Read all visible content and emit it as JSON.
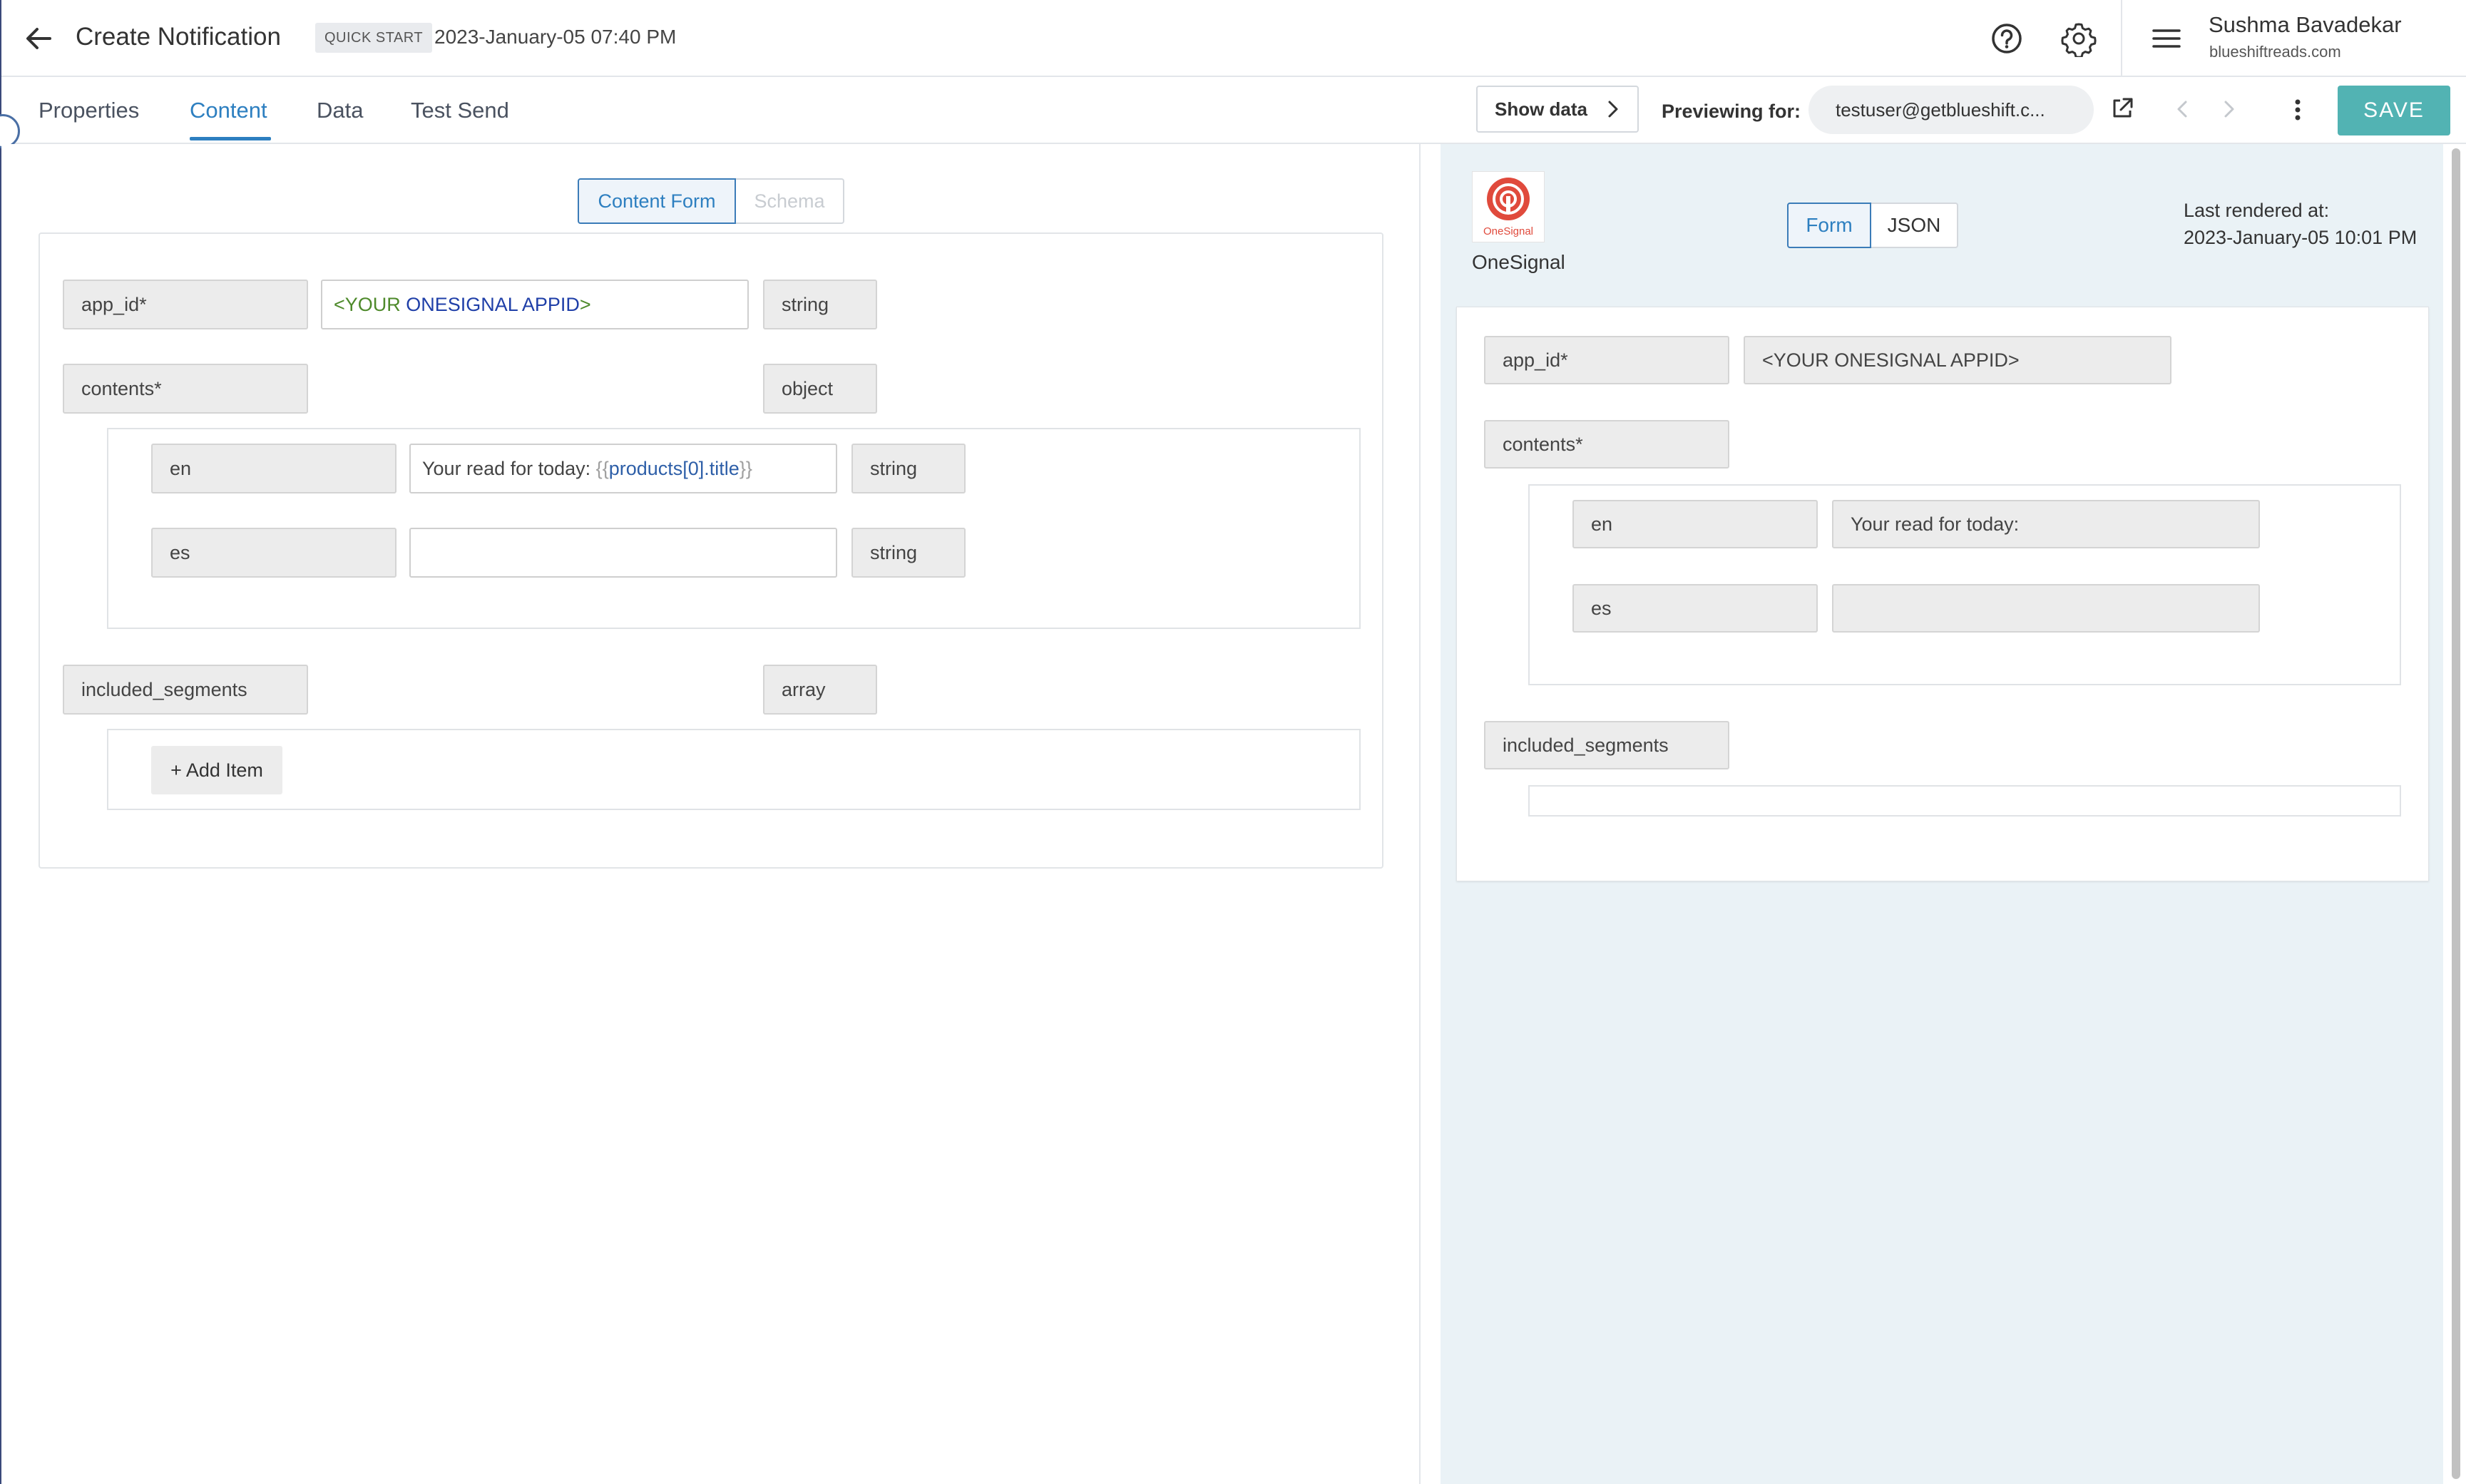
{
  "header": {
    "title": "Create Notification",
    "badge": "QUICK START",
    "timestamp": "2023-January-05 07:40 PM",
    "user_name": "Sushma Bavadekar",
    "user_org": "blueshiftreads.com",
    "icons": [
      "back-arrow-icon",
      "help-icon",
      "gear-icon",
      "menu-icon"
    ]
  },
  "tabs": {
    "items": [
      "Properties",
      "Content",
      "Data",
      "Test Send"
    ],
    "active": "Content"
  },
  "toolbar": {
    "show_data": "Show data",
    "previewing_label": "Previewing for:",
    "preview_user": "testuser@getblueshift.c...",
    "save": "SAVE"
  },
  "editor": {
    "modes": [
      "Content Form",
      "Schema"
    ],
    "active_mode": "Content Form",
    "fields": {
      "app_id": {
        "label": "app_id*",
        "value_open": "<YOUR ",
        "value_mid": "ONESIGNAL APPID",
        "value_close": ">",
        "type": "string"
      },
      "contents": {
        "label": "contents*",
        "type": "object"
      },
      "en": {
        "label": "en",
        "value_text": "Your read for today: ",
        "value_open": "{{",
        "value_var": "products[0].title",
        "value_close": "}}",
        "type": "string"
      },
      "es": {
        "label": "es",
        "value": "",
        "type": "string"
      },
      "included_segments": {
        "label": "included_segments",
        "type": "array"
      }
    },
    "add_item": "+ Add Item"
  },
  "preview": {
    "provider_name": "OneSignal",
    "logo_text": "OneSignal",
    "view_modes": [
      "Form",
      "JSON"
    ],
    "active_view": "Form",
    "last_rendered_label": "Last rendered at:",
    "last_rendered_time": "2023-January-05 10:01 PM",
    "fields": {
      "app_id": {
        "label": "app_id*",
        "value": "<YOUR ONESIGNAL APPID>"
      },
      "contents": {
        "label": "contents*"
      },
      "en": {
        "label": "en",
        "value": "Your read for today:"
      },
      "es": {
        "label": "es",
        "value": ""
      },
      "included_segments": {
        "label": "included_segments"
      }
    }
  },
  "colors": {
    "accent": "#2d7fc0",
    "save_button": "#52b3b3",
    "preview_background": "#eaf2f6",
    "onesignal_red": "#e04a3c"
  }
}
